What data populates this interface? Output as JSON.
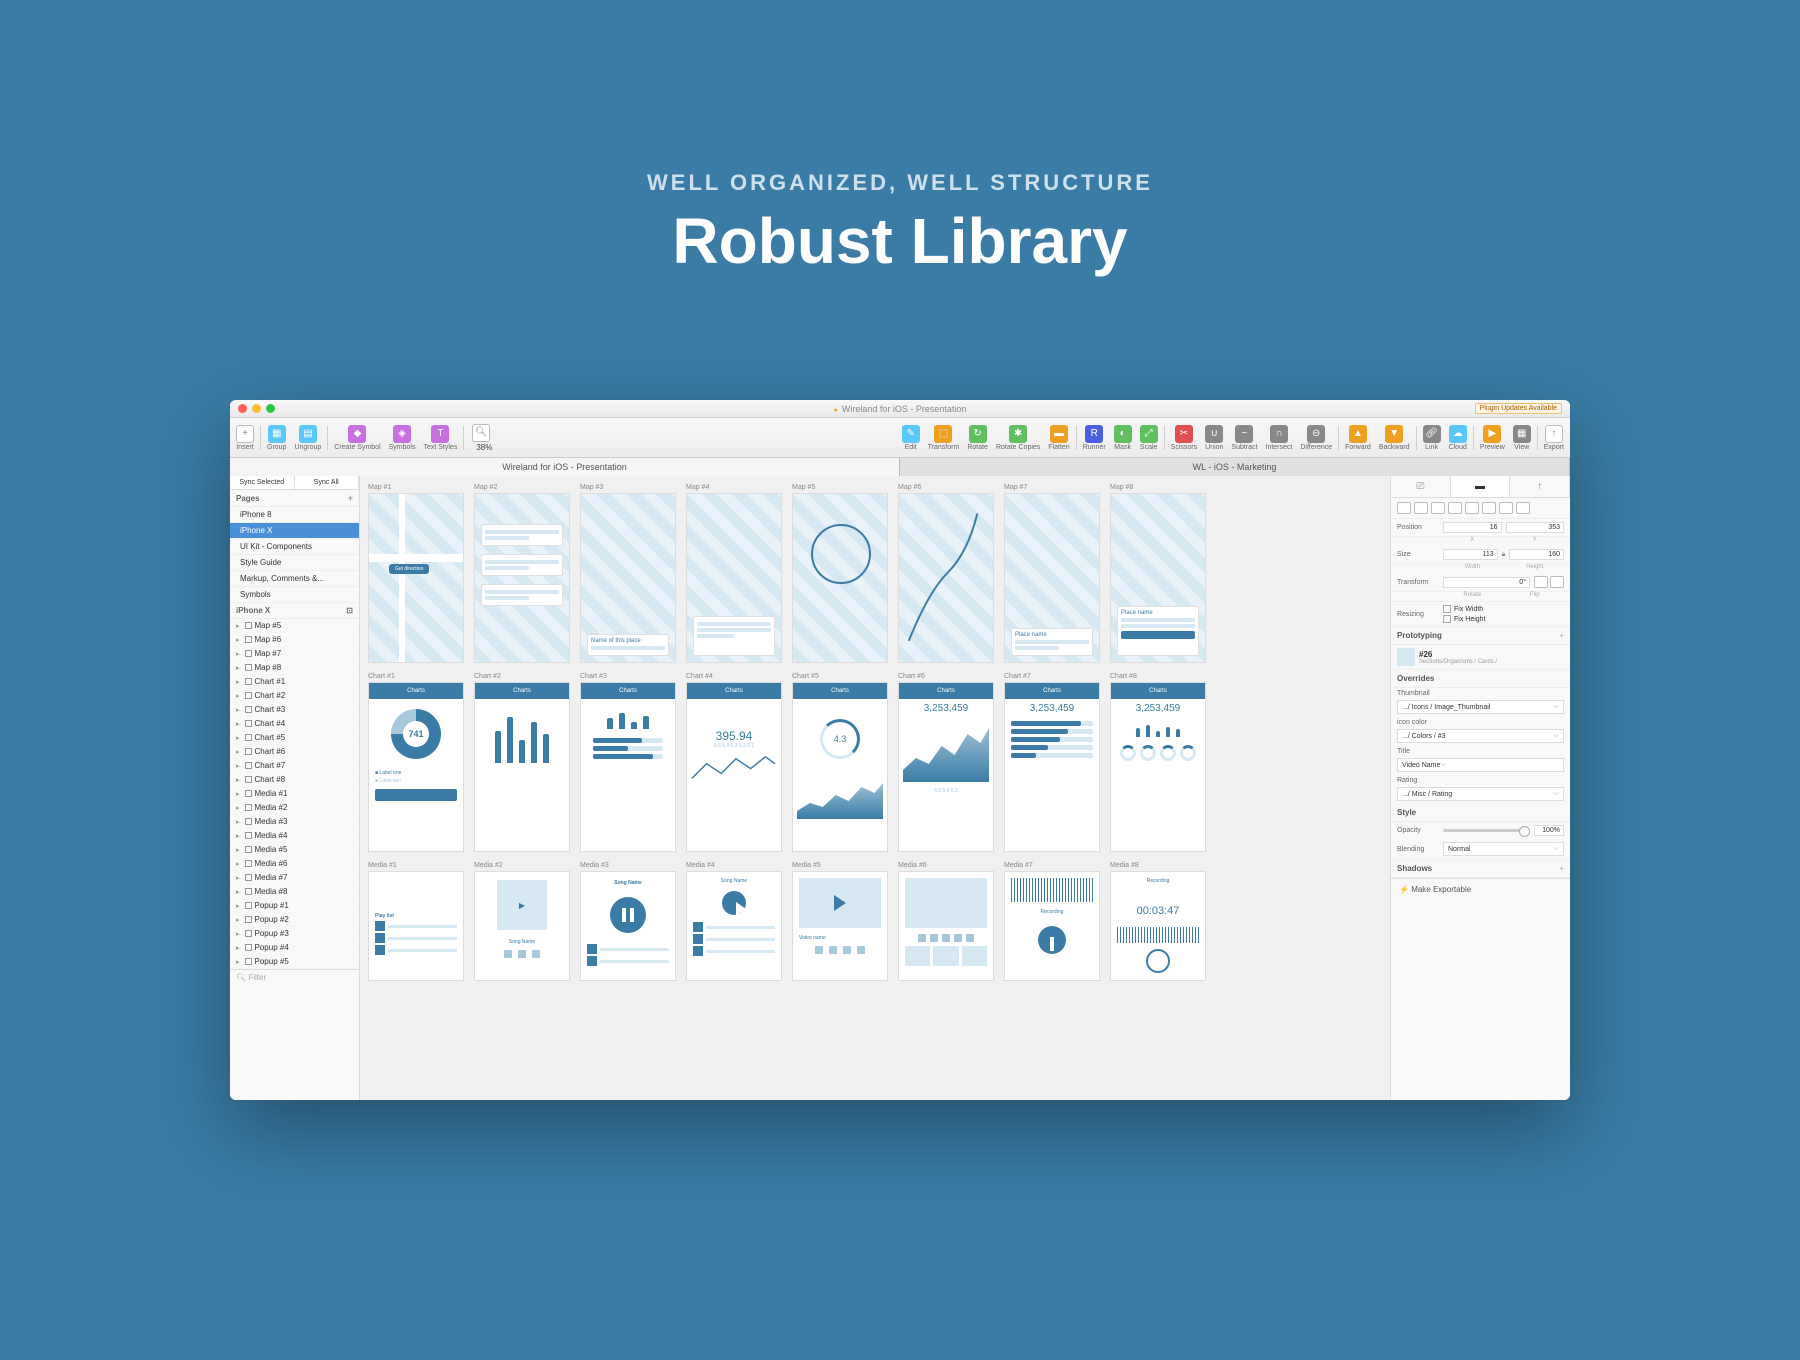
{
  "hero": {
    "subtitle": "WELL ORGANIZED, WELL STRUCTURE",
    "title": "Robust Library"
  },
  "window": {
    "title": "Wireland for iOS - Presentation",
    "plugin_badge": "Plugin Updates Available"
  },
  "toolbar": {
    "insert": "Insert",
    "group": "Group",
    "ungroup": "Ungroup",
    "create_symbol": "Create Symbol",
    "symbols": "Symbols",
    "text_styles": "Text Styles",
    "zoom": "38%",
    "edit": "Edit",
    "transform": "Transform",
    "rotate": "Rotate",
    "rotate_copies": "Rotate Copies",
    "flatten": "Flatten",
    "runner": "Runner",
    "mask": "Mask",
    "scale": "Scale",
    "scissors": "Scissors",
    "union": "Union",
    "subtract": "Subtract",
    "intersect": "Intersect",
    "difference": "Difference",
    "forward": "Forward",
    "backward": "Backward",
    "link": "Link",
    "cloud": "Cloud",
    "preview": "Preview",
    "view": "View",
    "export": "Export"
  },
  "doc_tabs": {
    "tab1": "Wireland for iOS - Presentation",
    "tab2": "WL - iOS - Marketing"
  },
  "sidebar": {
    "sync_selected": "Sync Selected",
    "sync_all": "Sync All",
    "pages_header": "Pages",
    "pages": [
      "iPhone 8",
      "iPhone X",
      "UI Kit - Components",
      "Style Guide",
      "Markup, Comments &...",
      "Symbols"
    ],
    "layers_header": "iPhone X",
    "layers": [
      "Map #5",
      "Map #6",
      "Map #7",
      "Map #8",
      "Chart #1",
      "Chart #2",
      "Chart #3",
      "Chart #4",
      "Chart #5",
      "Chart #6",
      "Chart #7",
      "Chart #8",
      "Media #1",
      "Media #2",
      "Media #3",
      "Media #4",
      "Media #5",
      "Media #6",
      "Media #7",
      "Media #8",
      "Popup #1",
      "Popup #2",
      "Popup #3",
      "Popup #4",
      "Popup #5"
    ],
    "filter": "Filter"
  },
  "canvas": {
    "maps": [
      "Map #1",
      "Map #2",
      "Map #3",
      "Map #4",
      "Map #5",
      "Map #6",
      "Map #7",
      "Map #8"
    ],
    "charts": [
      "Chart #1",
      "Chart #2",
      "Chart #3",
      "Chart #4",
      "Chart #5",
      "Chart #6",
      "Chart #7",
      "Chart #8"
    ],
    "media": [
      "Media #1",
      "Media #2",
      "Media #3",
      "Media #4",
      "Media #5",
      "Media #6",
      "Media #7",
      "Media #8"
    ],
    "header_label": "Map",
    "chart_header": "Charts",
    "list_label": "Play list",
    "place_label": "Place name",
    "name_place": "Name of this place",
    "direction_btn": "Get direction",
    "donut_val": "741",
    "big_num": "395.94",
    "gauge_val": "4.3",
    "stat_num": "3,253,459",
    "stat_num2": "3,253,459",
    "stat_num3": "3,253,459",
    "song_name": "Song Name",
    "video_name": "Video name",
    "recording": "Recording",
    "rec_time": "00:03:47",
    "axis_labels": "5.5   5.4   5.3   5.2   5.1"
  },
  "inspector": {
    "position_label": "Position",
    "pos_x": "16",
    "pos_y": "353",
    "x_label": "X",
    "y_label": "Y",
    "size_label": "Size",
    "width": "113",
    "height": "160",
    "w_label": "Width",
    "h_label": "Height",
    "transform_label": "Transform",
    "transform_val": "0°",
    "rotate_label": "Rotate",
    "flip_label": "Flip",
    "resizing_label": "Resizing",
    "fix_width": "Fix Width",
    "fix_height": "Fix Height",
    "prototyping": "Prototyping",
    "symbol_name": "#26",
    "symbol_path": "Sections/Organisms / Cards /",
    "overrides": "Overrides",
    "ov_thumbnail": "Thumbnail",
    "ov_thumb_val": ".../ Icons / Image_Thumbnail",
    "ov_icon_color": "icon color",
    "ov_icon_val": ".../ Colors / #3",
    "ov_title": "Title",
    "ov_title_val": "Video Name",
    "ov_rating": "Rating",
    "ov_rating_val": ".../ Misc / Rating",
    "style": "Style",
    "opacity_label": "Opacity",
    "opacity_val": "100%",
    "blending_label": "Blending",
    "blending_val": "Normal",
    "shadows": "Shadows",
    "make_exportable": "Make Exportable"
  }
}
